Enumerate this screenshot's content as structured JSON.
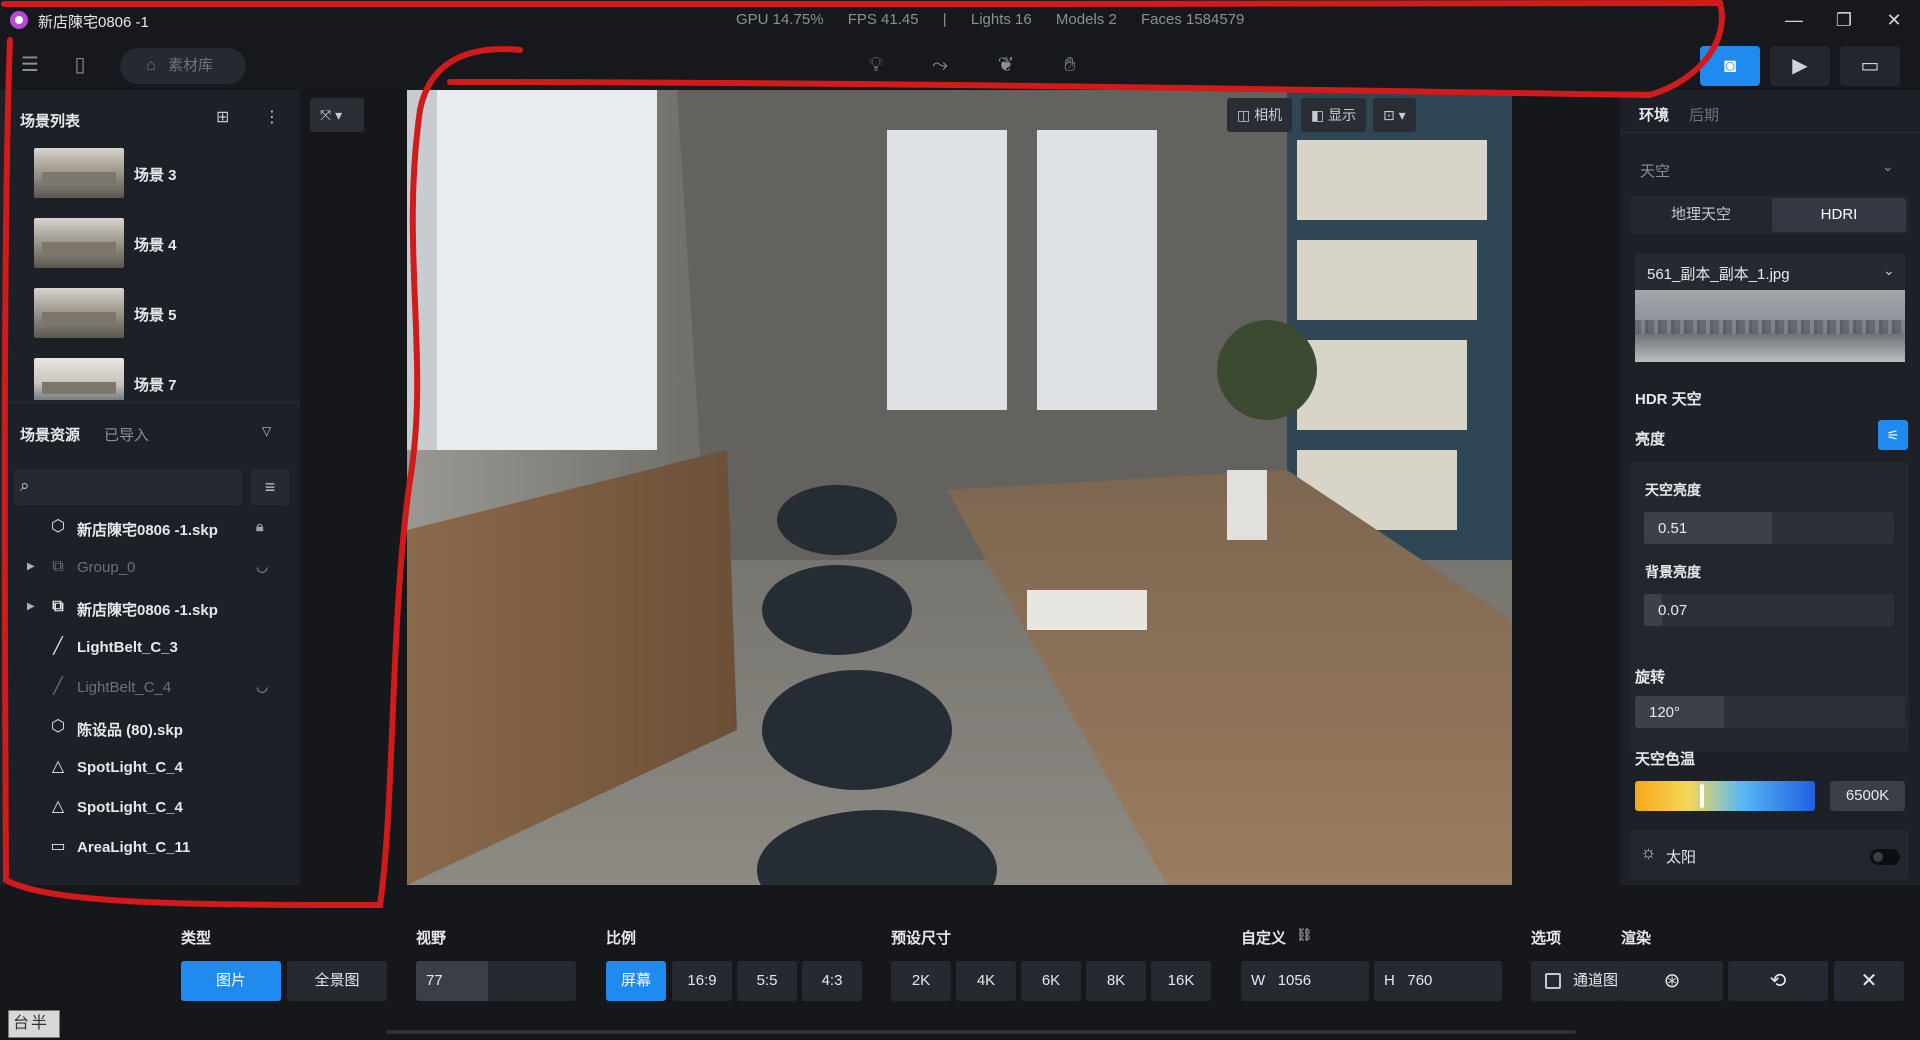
{
  "window": {
    "title": "新店陳宅0806 -1",
    "stats": [
      "GPU 14.75%",
      "FPS 41.45",
      "|",
      "Lights 16",
      "Models 2",
      "Faces 1584579"
    ],
    "controls": [
      "—",
      "❐",
      "✕"
    ]
  },
  "toolbar": {
    "material_library": "素材库"
  },
  "scene_list": {
    "title": "场景列表",
    "items": [
      {
        "label": "场景 3"
      },
      {
        "label": "场景 4"
      },
      {
        "label": "场景 5"
      },
      {
        "label": "场景 7"
      }
    ]
  },
  "assets": {
    "tab_active": "场景资源",
    "tab_inactive": "已导入",
    "search_placeholder": "",
    "tree": [
      {
        "label": "新店陳宅0806 -1.skp",
        "icon": "cube-icon",
        "dim": false,
        "arrow": "",
        "end": "lock-icon"
      },
      {
        "label": "Group_0",
        "icon": "group-icon",
        "dim": true,
        "arrow": "▶",
        "end": "hidden-eye-icon"
      },
      {
        "label": "新店陳宅0806 -1.skp",
        "icon": "group-icon",
        "dim": false,
        "arrow": "▶",
        "end": ""
      },
      {
        "label": "LightBelt_C_3",
        "icon": "line-icon",
        "dim": false,
        "arrow": "",
        "end": ""
      },
      {
        "label": "LightBelt_C_4",
        "icon": "line-icon",
        "dim": true,
        "arrow": "",
        "end": "hidden-eye-icon"
      },
      {
        "label": "陈设品 (80).skp",
        "icon": "cube-icon",
        "dim": false,
        "arrow": "",
        "end": ""
      },
      {
        "label": "SpotLight_C_4",
        "icon": "spotlight-icon",
        "dim": false,
        "arrow": "",
        "end": ""
      },
      {
        "label": "SpotLight_C_4",
        "icon": "spotlight-icon",
        "dim": false,
        "arrow": "",
        "end": ""
      },
      {
        "label": "AreaLight_C_11",
        "icon": "arealight-icon",
        "dim": false,
        "arrow": "",
        "end": ""
      }
    ]
  },
  "viewport": {
    "camera_label": "相机",
    "display_label": "显示"
  },
  "env_panel": {
    "tab_active": "环境",
    "tab_inactive": "后期",
    "sky_section": "天空",
    "seg_geo": "地理天空",
    "seg_hdri": "HDRI",
    "hdri_file": "561_副本_副本_1.jpg",
    "hdr_sky": "HDR 天空",
    "brightness": "亮度",
    "sky_brightness_label": "天空亮度",
    "sky_brightness_value": "0.51",
    "sky_brightness_level": 0.51,
    "bg_brightness_label": "背景亮度",
    "bg_brightness_value": "0.07",
    "bg_brightness_level": 0.07,
    "rotation_label": "旋转",
    "rotation_value": "120°",
    "rotation_level": 0.33,
    "color_temp_label": "天空色温",
    "color_temp_value": "6500K",
    "color_temp_level": 0.36,
    "sun_label": "太阳",
    "sun_on": false
  },
  "bottom": {
    "type_label": "类型",
    "type_image": "图片",
    "type_panorama": "全景图",
    "fov_label": "视野",
    "fov_value": "77",
    "ratio_label": "比例",
    "ratios": [
      "屏幕",
      "16:9",
      "5:5",
      "4:3"
    ],
    "preset_label": "预设尺寸",
    "presets": [
      "2K",
      "4K",
      "6K",
      "8K",
      "16K"
    ],
    "custom_label": "自定义",
    "width_prefix": "W",
    "width_value": "1056",
    "height_prefix": "H",
    "height_value": "760",
    "options_label": "选项",
    "channel_label": "通道图",
    "render_label": "渲染"
  },
  "ime": "台半",
  "colors": {
    "accent": "#1f8bf0",
    "annotation": "#d11a1a"
  }
}
